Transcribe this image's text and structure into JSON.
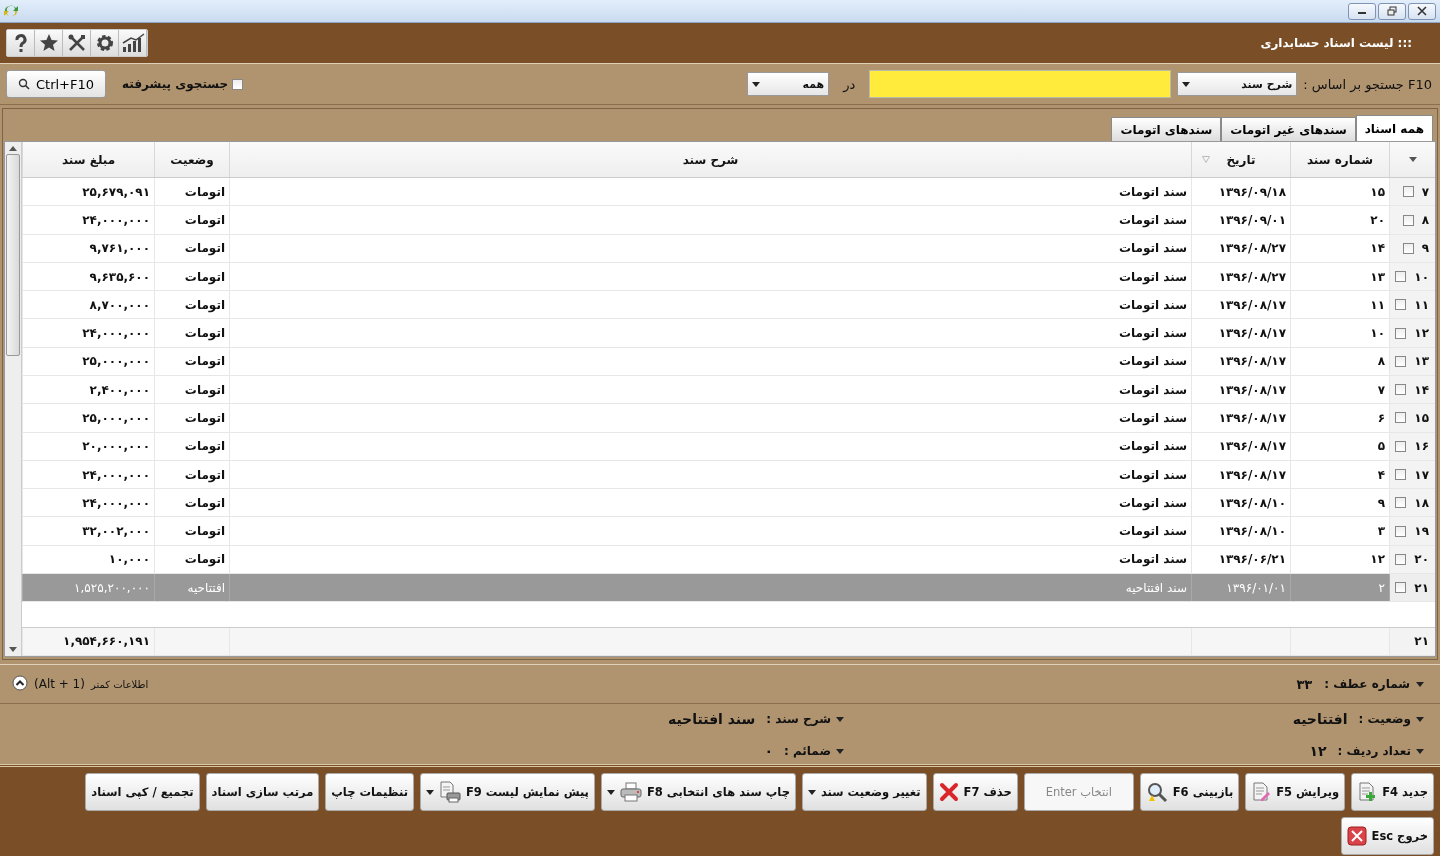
{
  "window": {
    "title": "::: لیست اسناد حسابداری"
  },
  "search": {
    "label": "F10 جستجو بر اساس :",
    "field_dropdown": "شرح سند",
    "in_label": "در",
    "scope_dropdown": "همه",
    "advanced": {
      "label": "جستجوی پیشرفته",
      "checked": false
    },
    "button": "Ctrl+F10"
  },
  "tabs": [
    {
      "label": "همه اسناد",
      "selected": true
    },
    {
      "label": "سندهای غیر اتومات",
      "selected": false
    },
    {
      "label": "سندهای اتومات",
      "selected": false
    }
  ],
  "table": {
    "columns": [
      "شماره سند",
      "تاریخ",
      "شرح سند",
      "وضعیت",
      "مبلغ سند"
    ],
    "rows": [
      {
        "row": "۷",
        "checked": false,
        "number": "۱۵",
        "date": "۱۳۹۶/۰۹/۱۸",
        "description": "سند اتومات",
        "status": "اتومات",
        "amount": "۲۵,۶۷۹,۰۹۱",
        "selected": false
      },
      {
        "row": "۸",
        "checked": false,
        "number": "۲۰",
        "date": "۱۳۹۶/۰۹/۰۱",
        "description": "سند اتومات",
        "status": "اتومات",
        "amount": "۲۴,۰۰۰,۰۰۰",
        "selected": false
      },
      {
        "row": "۹",
        "checked": false,
        "number": "۱۴",
        "date": "۱۳۹۶/۰۸/۲۷",
        "description": "سند اتومات",
        "status": "اتومات",
        "amount": "۹,۷۶۱,۰۰۰",
        "selected": false
      },
      {
        "row": "۱۰",
        "checked": false,
        "number": "۱۳",
        "date": "۱۳۹۶/۰۸/۲۷",
        "description": "سند اتومات",
        "status": "اتومات",
        "amount": "۹,۶۳۵,۶۰۰",
        "selected": false
      },
      {
        "row": "۱۱",
        "checked": false,
        "number": "۱۱",
        "date": "۱۳۹۶/۰۸/۱۷",
        "description": "سند اتومات",
        "status": "اتومات",
        "amount": "۸,۷۰۰,۰۰۰",
        "selected": false
      },
      {
        "row": "۱۲",
        "checked": false,
        "number": "۱۰",
        "date": "۱۳۹۶/۰۸/۱۷",
        "description": "سند اتومات",
        "status": "اتومات",
        "amount": "۲۴,۰۰۰,۰۰۰",
        "selected": false
      },
      {
        "row": "۱۳",
        "checked": false,
        "number": "۸",
        "date": "۱۳۹۶/۰۸/۱۷",
        "description": "سند اتومات",
        "status": "اتومات",
        "amount": "۲۵,۰۰۰,۰۰۰",
        "selected": false
      },
      {
        "row": "۱۴",
        "checked": false,
        "number": "۷",
        "date": "۱۳۹۶/۰۸/۱۷",
        "description": "سند اتومات",
        "status": "اتومات",
        "amount": "۲,۴۰۰,۰۰۰",
        "selected": false
      },
      {
        "row": "۱۵",
        "checked": false,
        "number": "۶",
        "date": "۱۳۹۶/۰۸/۱۷",
        "description": "سند اتومات",
        "status": "اتومات",
        "amount": "۲۵,۰۰۰,۰۰۰",
        "selected": false
      },
      {
        "row": "۱۶",
        "checked": false,
        "number": "۵",
        "date": "۱۳۹۶/۰۸/۱۷",
        "description": "سند اتومات",
        "status": "اتومات",
        "amount": "۲۰,۰۰۰,۰۰۰",
        "selected": false
      },
      {
        "row": "۱۷",
        "checked": false,
        "number": "۴",
        "date": "۱۳۹۶/۰۸/۱۷",
        "description": "سند اتومات",
        "status": "اتومات",
        "amount": "۲۴,۰۰۰,۰۰۰",
        "selected": false
      },
      {
        "row": "۱۸",
        "checked": false,
        "number": "۹",
        "date": "۱۳۹۶/۰۸/۱۰",
        "description": "سند اتومات",
        "status": "اتومات",
        "amount": "۲۴,۰۰۰,۰۰۰",
        "selected": false
      },
      {
        "row": "۱۹",
        "checked": false,
        "number": "۳",
        "date": "۱۳۹۶/۰۸/۱۰",
        "description": "سند اتومات",
        "status": "اتومات",
        "amount": "۳۲,۰۰۲,۰۰۰",
        "selected": false
      },
      {
        "row": "۲۰",
        "checked": false,
        "number": "۱۲",
        "date": "۱۳۹۶/۰۶/۲۱",
        "description": "سند اتومات",
        "status": "اتومات",
        "amount": "۱۰,۰۰۰",
        "selected": false
      },
      {
        "row": "۲۱",
        "checked": false,
        "number": "۲",
        "date": "۱۳۹۶/۰۱/۰۱",
        "description": "سند افتتاحیه",
        "status": "افتتاحیه",
        "amount": "۱,۵۲۵,۲۰۰,۰۰۰",
        "selected": true
      }
    ],
    "footer": {
      "count": "۲۱",
      "total": "۱,۹۵۴,۶۶۰,۱۹۱"
    }
  },
  "summary": {
    "label": "شماره عطف :",
    "value": "۳۳",
    "toggle_label": "اطلاعات کمتر",
    "toggle_shortcut": "(Alt + 1)",
    "expanded": true
  },
  "details": {
    "status": {
      "label": "وضعیت :",
      "value": "افتتاحیه"
    },
    "description": {
      "label": "شرح سند :",
      "value": "سند افتتاحیه"
    },
    "row_count": {
      "label": "تعداد ردیف :",
      "value": "۱۲"
    },
    "attachments": {
      "label": "ضمائم :",
      "value": "۰"
    }
  },
  "buttons": [
    {
      "label": "جدید F4",
      "kind": "new",
      "dropdown": false,
      "disabled": false
    },
    {
      "label": "ویرایش F5",
      "kind": "edit",
      "dropdown": false,
      "disabled": false
    },
    {
      "label": "بازبینی F6",
      "kind": "review",
      "dropdown": false,
      "disabled": false
    },
    {
      "label": "انتخاب Enter",
      "kind": "plain",
      "dropdown": false,
      "disabled": true
    },
    {
      "label": "حذف F7",
      "kind": "delete",
      "dropdown": false,
      "disabled": false
    },
    {
      "label": "تغییر وضعیت سند",
      "kind": "plain",
      "dropdown": true,
      "disabled": false
    },
    {
      "label": "چاپ سند های انتخابی F8",
      "kind": "print",
      "dropdown": true,
      "disabled": false
    },
    {
      "label": "پیش نمایش لیست F9",
      "kind": "preview",
      "dropdown": true,
      "disabled": false
    },
    {
      "label": "تنظیمات چاپ",
      "kind": "plain",
      "dropdown": false,
      "disabled": false
    },
    {
      "label": "مرتب سازی اسناد",
      "kind": "plain",
      "dropdown": false,
      "disabled": false
    },
    {
      "label": "تجمیع / کپی اسناد",
      "kind": "plain",
      "dropdown": false,
      "disabled": false
    }
  ],
  "exit_button": {
    "label": "خروج Esc",
    "kind": "exit"
  }
}
